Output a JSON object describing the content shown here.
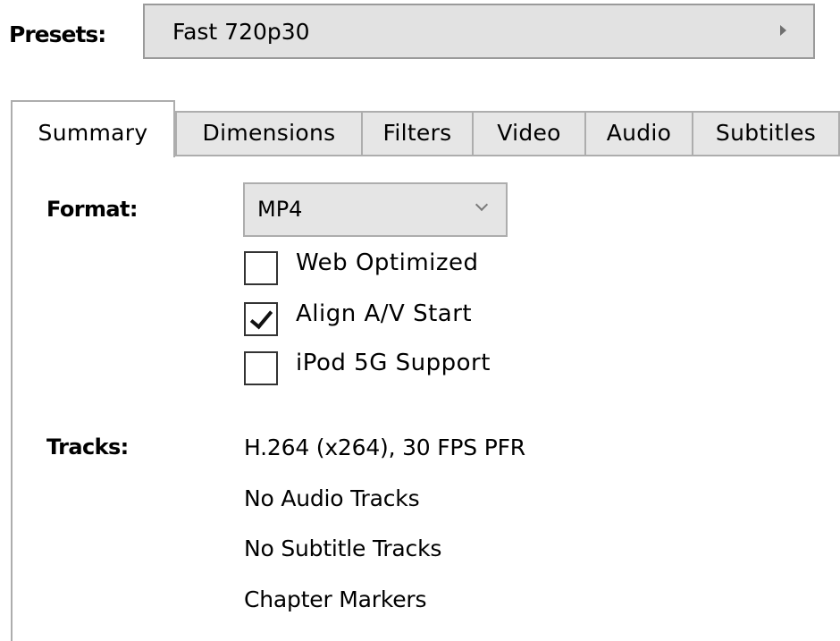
{
  "presets": {
    "label": "Presets:",
    "value": "Fast 720p30",
    "arrow_icon": "triangle-right-icon"
  },
  "tabs": [
    {
      "label": "Summary",
      "active": true
    },
    {
      "label": "Dimensions",
      "active": false
    },
    {
      "label": "Filters",
      "active": false
    },
    {
      "label": "Video",
      "active": false
    },
    {
      "label": "Audio",
      "active": false
    },
    {
      "label": "Subtitles",
      "active": false
    }
  ],
  "summary": {
    "format_label": "Format:",
    "format_value": "MP4",
    "format_dropdown_icon": "chevron-down-icon",
    "options": [
      {
        "label": "Web Optimized",
        "checked": false
      },
      {
        "label": "Align A/V Start",
        "checked": true
      },
      {
        "label": "iPod 5G Support",
        "checked": false
      }
    ],
    "tracks_label": "Tracks:",
    "tracks": [
      "H.264 (x264), 30 FPS PFR",
      "No Audio Tracks",
      "No Subtitle Tracks",
      "Chapter Markers"
    ]
  }
}
